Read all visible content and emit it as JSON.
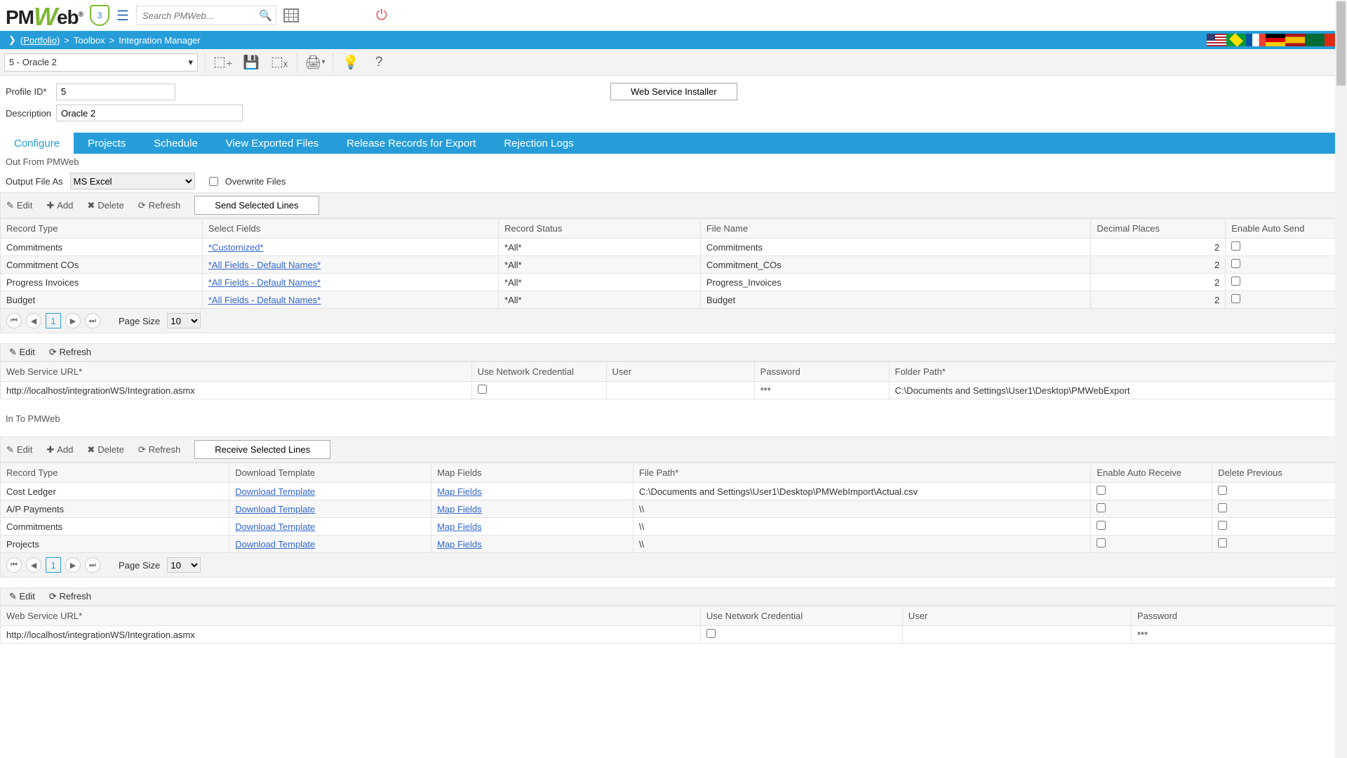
{
  "header": {
    "shield_count": "3",
    "search_placeholder": "Search PMWeb..."
  },
  "breadcrumb": {
    "portfolio": "(Portfolio)",
    "level2": "Toolbox",
    "level3": "Integration Manager"
  },
  "record_selector": "5 - Oracle 2",
  "form": {
    "profile_id_label": "Profile ID*",
    "profile_id": "5",
    "description_label": "Description",
    "description": "Oracle 2",
    "ws_installer": "Web Service Installer"
  },
  "tabs": [
    "Configure",
    "Projects",
    "Schedule",
    "View Exported Files",
    "Release Records for Export",
    "Rejection Logs"
  ],
  "out_section": {
    "title": "Out From PMWeb",
    "output_as_label": "Output File As",
    "output_as": "MS Excel",
    "overwrite_label": "Overwrite Files"
  },
  "grid_toolbar": {
    "edit": "Edit",
    "add": "Add",
    "delete": "Delete",
    "refresh": "Refresh",
    "send": "Send Selected Lines"
  },
  "out_cols": [
    "Record Type",
    "Select Fields",
    "Record Status",
    "File Name",
    "Decimal Places",
    "Enable Auto Send"
  ],
  "out_rows": [
    {
      "type": "Commitments",
      "fields": "*Customized*",
      "status": "*All*",
      "file": "Commitments",
      "dec": "2"
    },
    {
      "type": "Commitment COs",
      "fields": "*All Fields - Default Names*",
      "status": "*All*",
      "file": "Commitment_COs",
      "dec": "2"
    },
    {
      "type": "Progress Invoices",
      "fields": "*All Fields - Default Names*",
      "status": "*All*",
      "file": "Progress_Invoices",
      "dec": "2"
    },
    {
      "type": "Budget",
      "fields": "*All Fields - Default Names*",
      "status": "*All*",
      "file": "Budget",
      "dec": "2"
    }
  ],
  "pager": {
    "page": "1",
    "size_label": "Page Size",
    "size": "10"
  },
  "ws_out_cols": [
    "Web Service URL*",
    "Use Network Credential",
    "User",
    "Password",
    "Folder Path*"
  ],
  "ws_out": {
    "url": "http://localhost/integrationWS/Integration.asmx",
    "user": "",
    "pass": "***",
    "folder": "C:\\Documents and Settings\\User1\\Desktop\\PMWebExport"
  },
  "in_section": {
    "title": "In To PMWeb"
  },
  "grid_toolbar2": {
    "receive": "Receive Selected Lines"
  },
  "in_cols": [
    "Record Type",
    "Download Template",
    "Map Fields",
    "File Path*",
    "Enable Auto Receive",
    "Delete Previous"
  ],
  "in_rows": [
    {
      "type": "Cost Ledger",
      "dl": "Download Template",
      "map": "Map Fields",
      "path": "C:\\Documents and Settings\\User1\\Desktop\\PMWebImport\\Actual.csv"
    },
    {
      "type": "A/P Payments",
      "dl": "Download Template",
      "map": "Map Fields",
      "path": "\\\\"
    },
    {
      "type": "Commitments",
      "dl": "Download Template",
      "map": "Map Fields",
      "path": "\\\\"
    },
    {
      "type": "Projects",
      "dl": "Download Template",
      "map": "Map Fields",
      "path": "\\\\"
    }
  ],
  "ws_in_cols": [
    "Web Service URL*",
    "Use Network Credential",
    "User",
    "Password"
  ],
  "ws_in": {
    "url": "http://localhost/integrationWS/Integration.asmx",
    "pass": "***"
  }
}
